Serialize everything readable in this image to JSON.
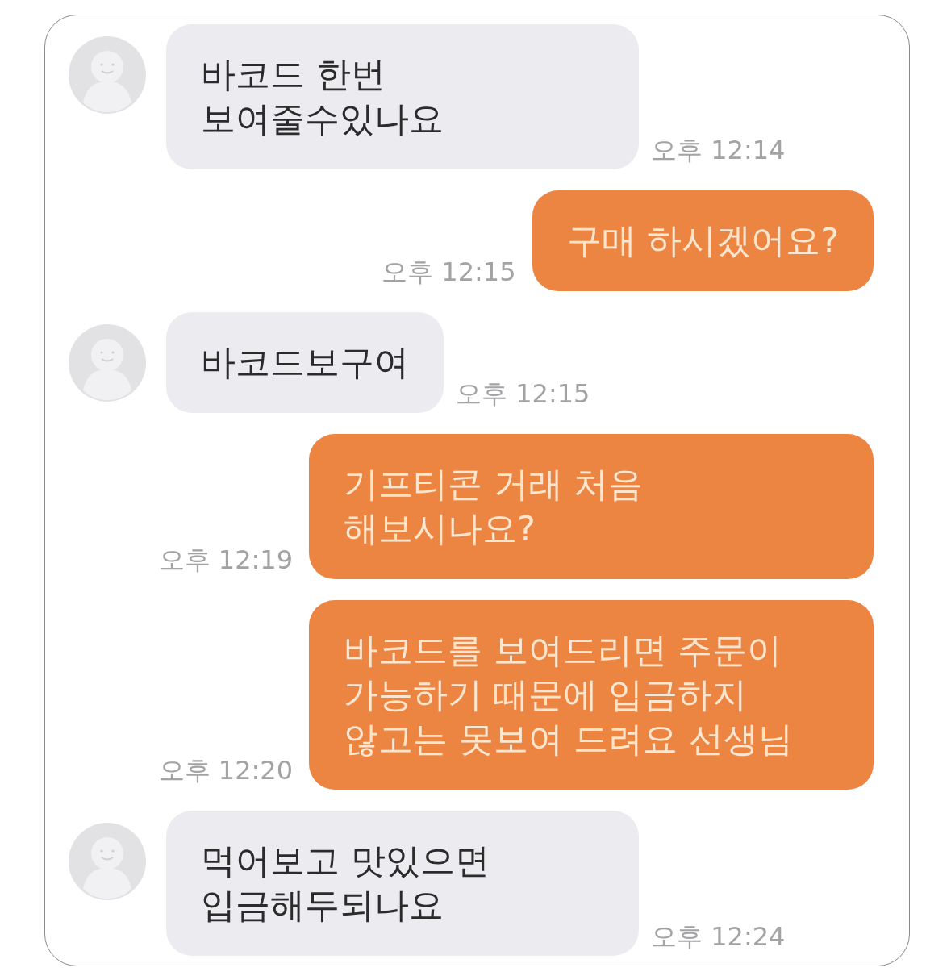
{
  "messages": [
    {
      "kind": "received",
      "text": "바코드 한번\n보여줄수있나요",
      "time": "오후 12:14"
    },
    {
      "kind": "sent",
      "text": "구매 하시겠어요?",
      "time": "오후 12:15"
    },
    {
      "kind": "received",
      "text": "바코드보구여",
      "time": "오후 12:15"
    },
    {
      "kind": "sent",
      "text": "기프티콘 거래 처음\n해보시나요?",
      "time": "오후 12:19"
    },
    {
      "kind": "sent",
      "text": "바코드를 보여드리면 주문이\n가능하기 때문에 입금하지\n않고는 못보여 드려요 선생님",
      "time": "오후 12:20"
    },
    {
      "kind": "received",
      "text": "먹어보고 맛있으면\n입금해두되나요",
      "time": "오후 12:24"
    }
  ]
}
